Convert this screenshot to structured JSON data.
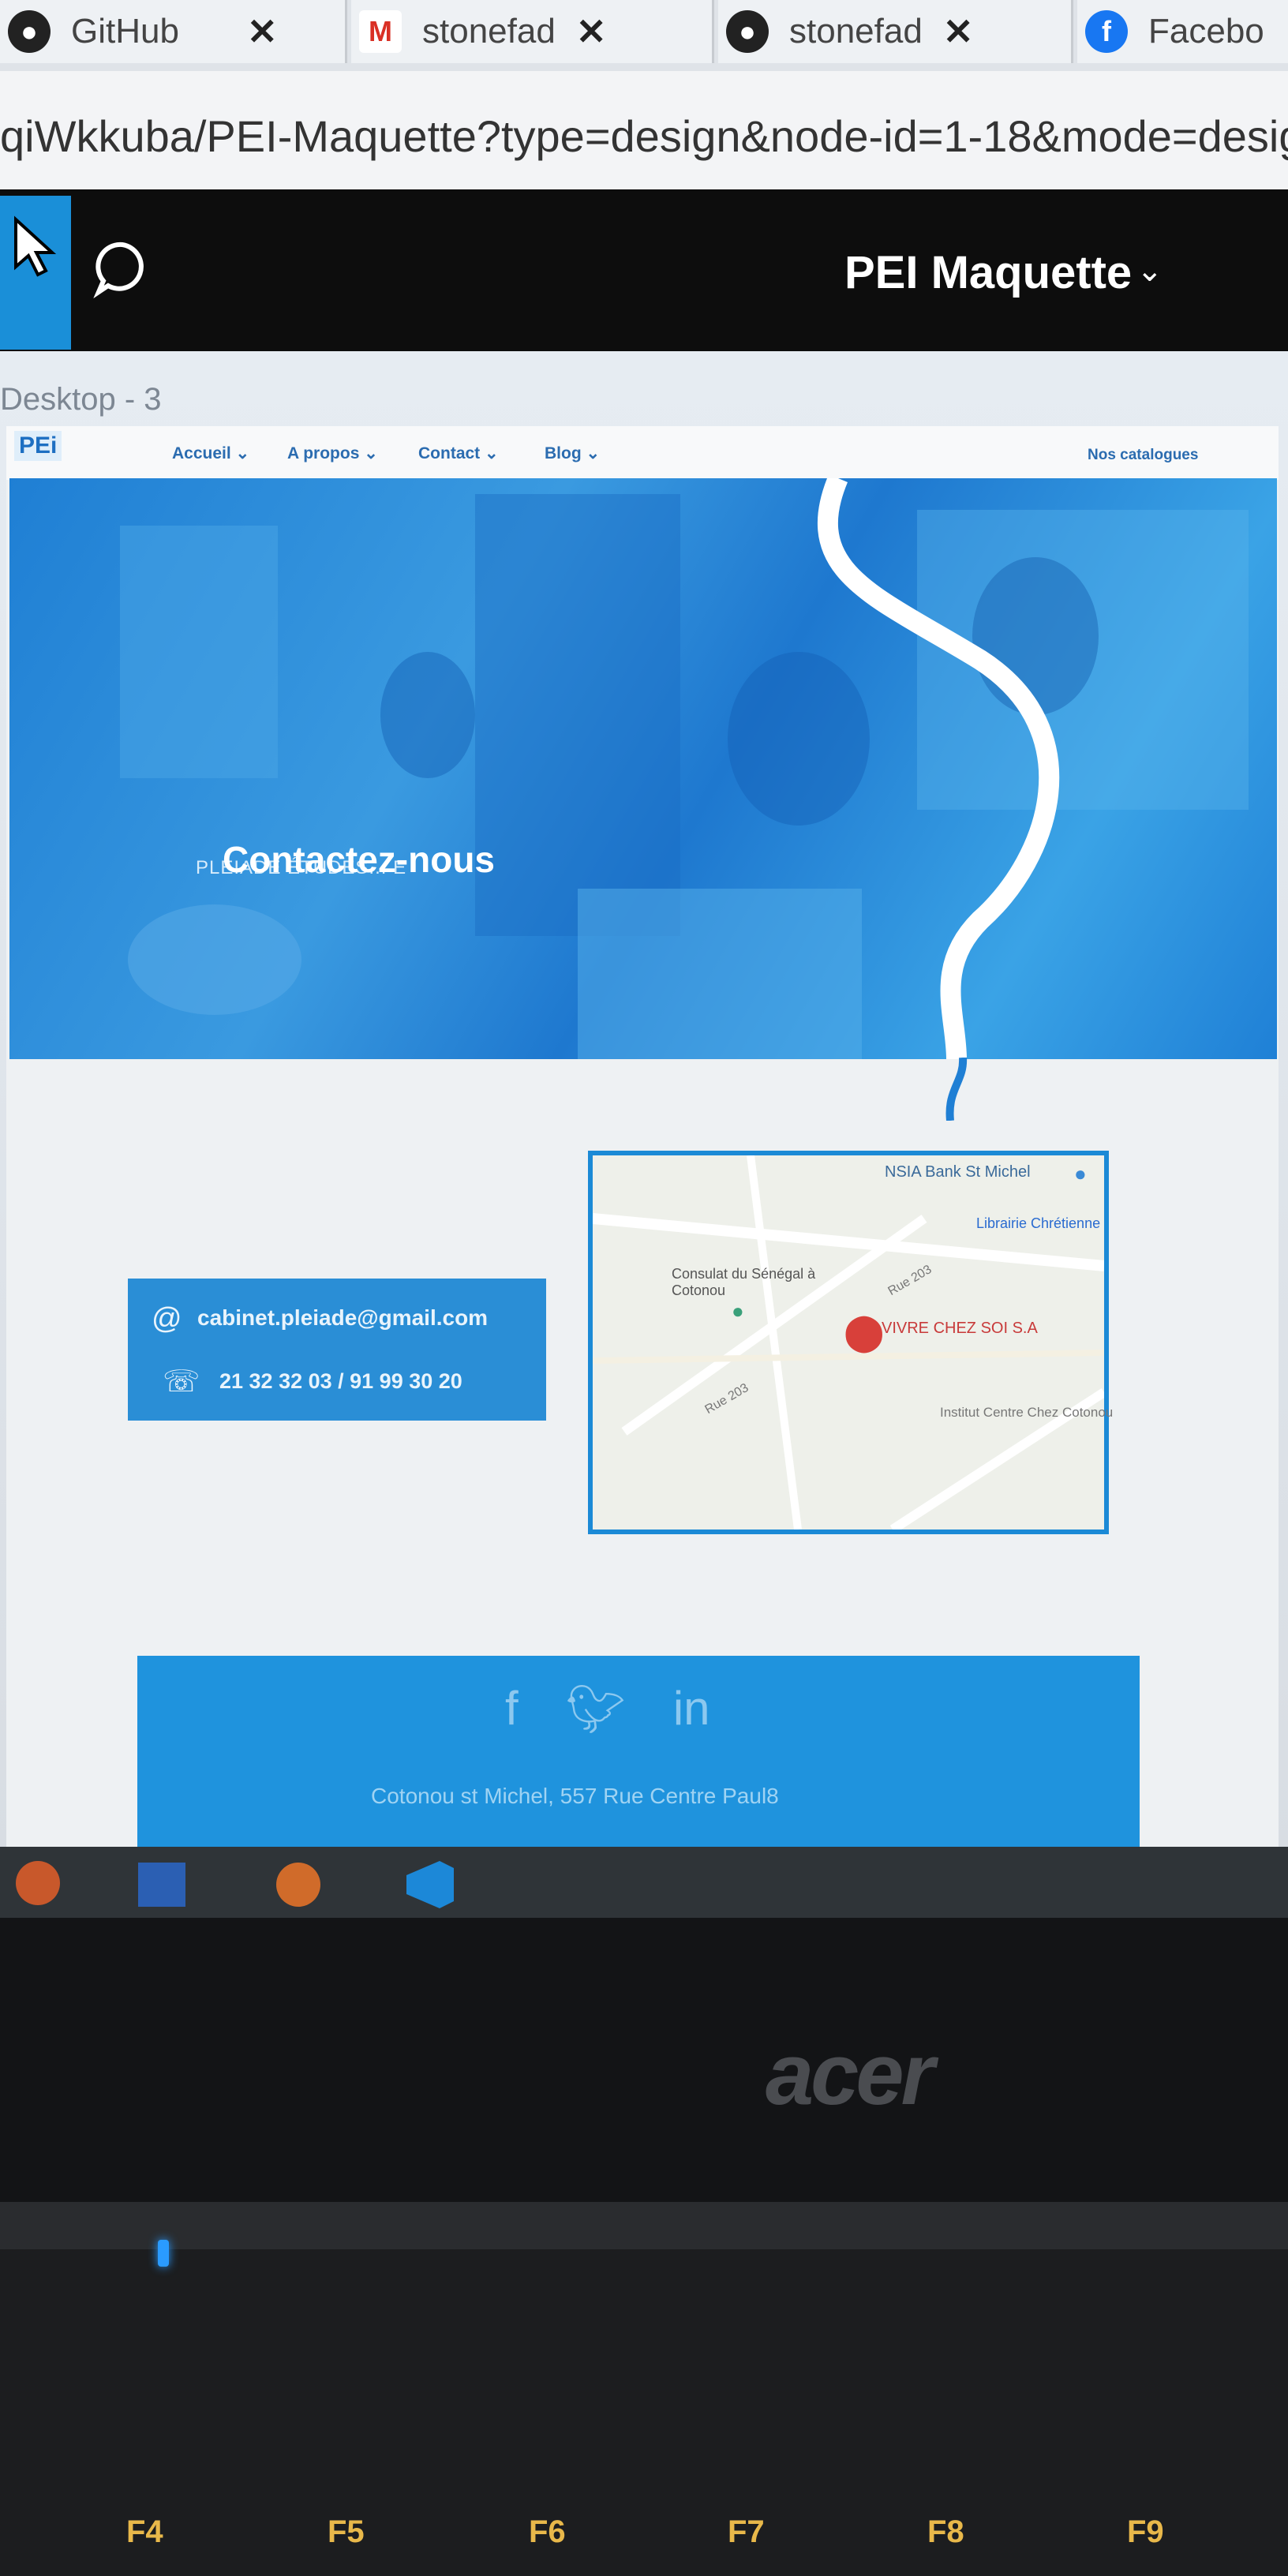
{
  "browser": {
    "tabs": [
      {
        "label": "GitHub",
        "icon": "github-icon"
      },
      {
        "label": "stonefad",
        "icon": "gmail-icon"
      },
      {
        "label": "stonefad",
        "icon": "github-icon"
      },
      {
        "label": "Facebo",
        "icon": "facebook-icon"
      }
    ],
    "close_glyph": "✕",
    "url": "qiWkkuba/PEI-Maquette?type=design&node-id=1-18&mode=desig"
  },
  "figma": {
    "file_title": "PEI Maquette",
    "frame_label": "Desktop - 3"
  },
  "site": {
    "logo": "PEi",
    "nav": [
      "Accueil",
      "A propos",
      "Contact",
      "Blog"
    ],
    "catalogues": "Nos catalogues",
    "hero": {
      "tagline": "PLEIADE ÉTUDES... E",
      "title": "Contactez-nous"
    },
    "contact": {
      "email": "cabinet.pleiade@gmail.com",
      "phone": "21 32 32 03 / 91 99 30 20"
    },
    "map": {
      "labels": [
        "NSIA Bank St Michel",
        "Librairie Chrétienne",
        "Consulat du Sénégal à Cotonou",
        "Rue 203",
        "VIVRE CHEZ SOI S.A",
        "Rue 203",
        "Institut Centre Chez Cotonou"
      ]
    },
    "footer": {
      "address": "Cotonou st Michel, 557 Rue Centre Paul8"
    }
  },
  "laptop": {
    "brand": "acer",
    "fkeys": [
      "F4",
      "F5",
      "F6",
      "F7",
      "F8",
      "F9"
    ]
  },
  "colors": {
    "accent": "#1f93dd",
    "hero": "#2a8ed6",
    "figma_bar": "#0d0d0d"
  }
}
